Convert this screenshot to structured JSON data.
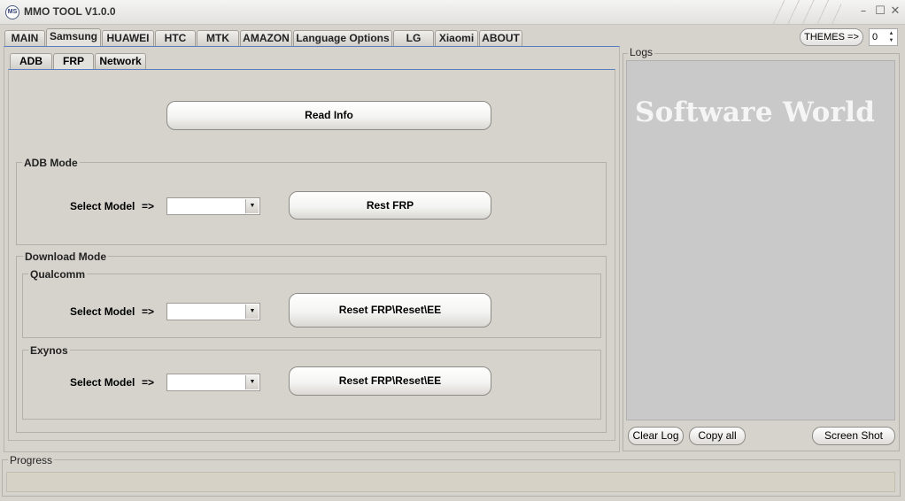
{
  "window": {
    "title": "MMO TOOL V1.0.0",
    "icon_text": "MS",
    "icon": "app-logo-icon",
    "controls": {
      "minimize": "–",
      "maximize": "☐",
      "close": "✕"
    }
  },
  "main_tabs": [
    {
      "label": "MAIN",
      "selected": false
    },
    {
      "label": "Samsung",
      "selected": true
    },
    {
      "label": "HUAWEI",
      "selected": false
    },
    {
      "label": "HTC",
      "selected": false
    },
    {
      "label": "MTK",
      "selected": false
    },
    {
      "label": "AMAZON",
      "selected": false
    },
    {
      "label": "Language Options",
      "selected": false
    },
    {
      "label": "LG",
      "selected": false
    },
    {
      "label": "Xiaomi",
      "selected": false
    },
    {
      "label": "ABOUT",
      "selected": false
    }
  ],
  "themes": {
    "button_label": "THEMES =>",
    "value": "0"
  },
  "sub_tabs": [
    {
      "label": "ADB",
      "selected": false
    },
    {
      "label": "FRP",
      "selected": true
    },
    {
      "label": "Network",
      "selected": false
    }
  ],
  "frp": {
    "read_info_label": "Read Info",
    "adb_mode": {
      "title": "ADB Mode",
      "select_label": "Select Model",
      "arrow": "=>",
      "selected_value": "",
      "action_label": "Rest FRP"
    },
    "download_mode": {
      "title": "Download Mode",
      "qualcomm": {
        "title": "Qualcomm",
        "select_label": "Select Model",
        "arrow": "=>",
        "selected_value": "",
        "action_label": "Reset FRP\\Reset\\EE"
      },
      "exynos": {
        "title": "Exynos",
        "select_label": "Select Model",
        "arrow": "=>",
        "selected_value": "",
        "action_label": "Reset FRP\\Reset\\EE"
      }
    }
  },
  "logs": {
    "title": "Logs",
    "text": "Software World",
    "clear_label": "Clear Log",
    "copy_label": "Copy all",
    "screenshot_label": "Screen Shot"
  },
  "progress": {
    "title": "Progress",
    "value": 0
  },
  "colors": {
    "background": "#d6d3cd",
    "log_background": "#c9c9c9",
    "progress_track": "#d7d2c6",
    "selected_tab_line": "#5a7ec0"
  }
}
